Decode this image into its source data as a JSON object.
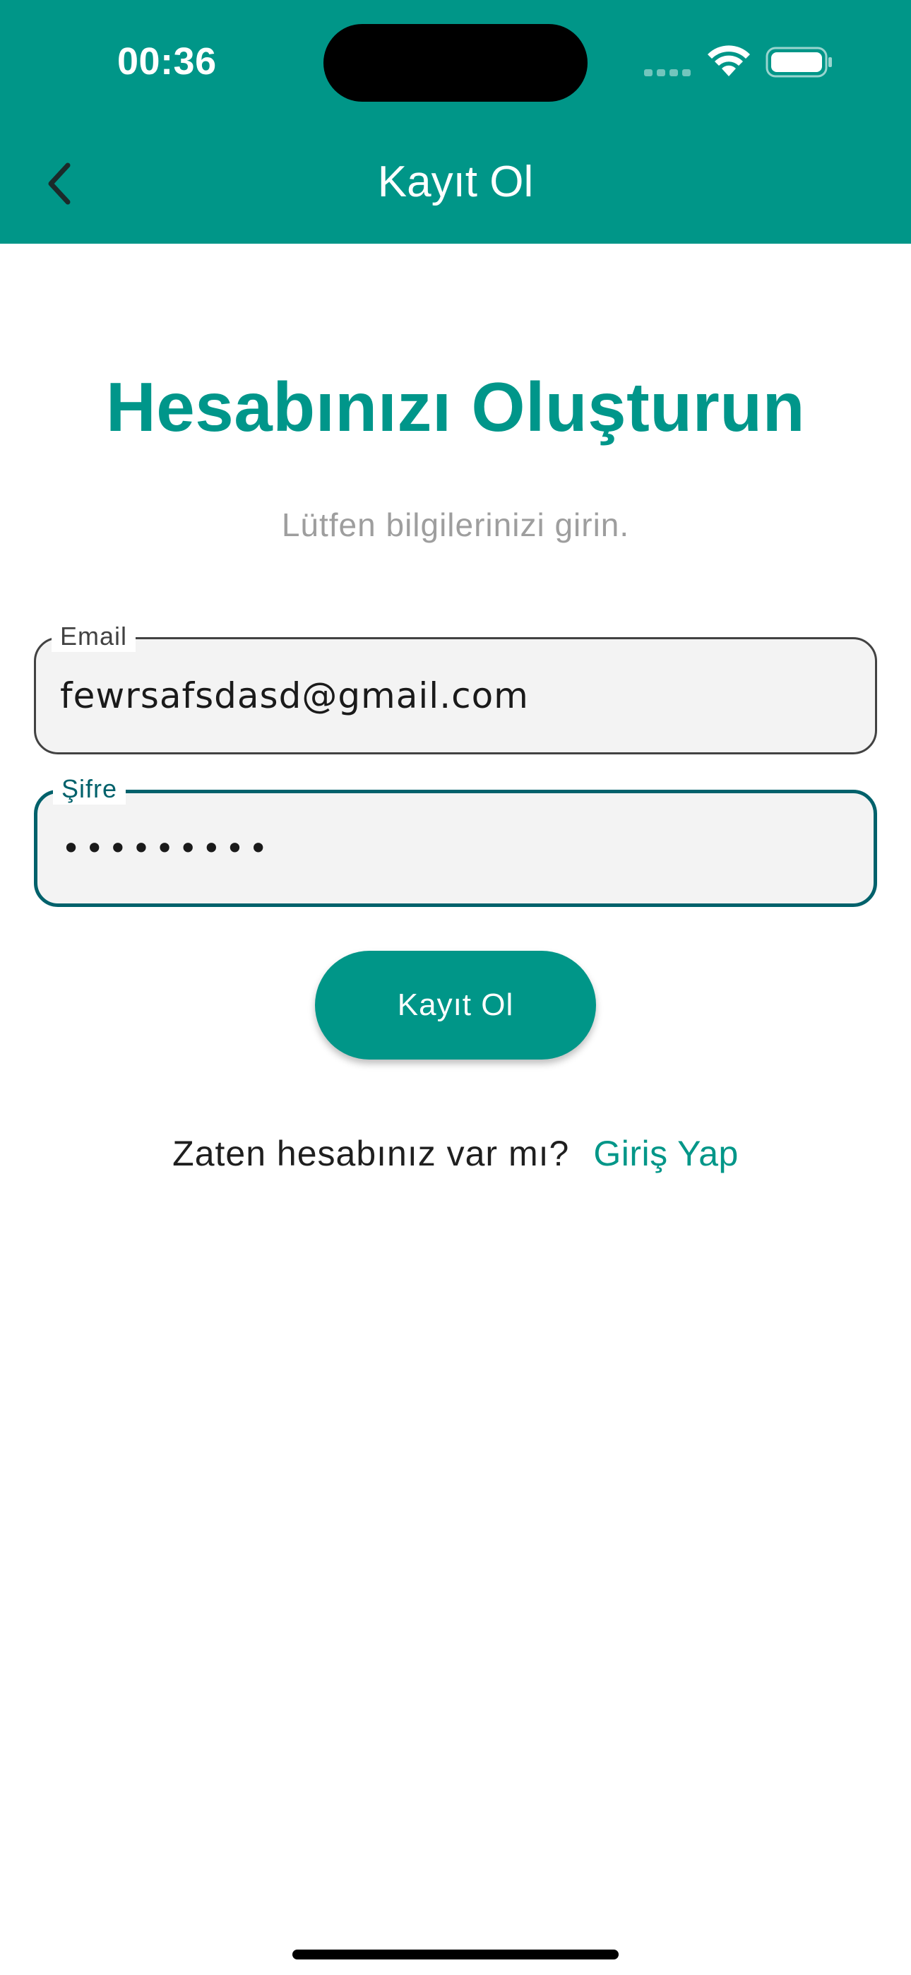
{
  "status_bar": {
    "time": "00:36"
  },
  "app_bar": {
    "title": "Kayıt Ol",
    "back_icon": "chevron-left-icon"
  },
  "main": {
    "heading": "Hesabınızı Oluşturun",
    "subtitle": "Lütfen bilgilerinizi girin.",
    "email_field": {
      "label": "Email",
      "value": "fewrsafsdasd@gmail.com"
    },
    "password_field": {
      "label": "Şifre",
      "value": "•••••••••"
    },
    "register_button_label": "Kayıt Ol",
    "login_prompt": "Zaten hesabınız var mı?",
    "login_link": "Giriş Yap"
  },
  "colors": {
    "primary": "#009688",
    "focused_border": "#00616b",
    "field_fill": "#f3f3f3",
    "subtitle": "#9e9e9e"
  }
}
